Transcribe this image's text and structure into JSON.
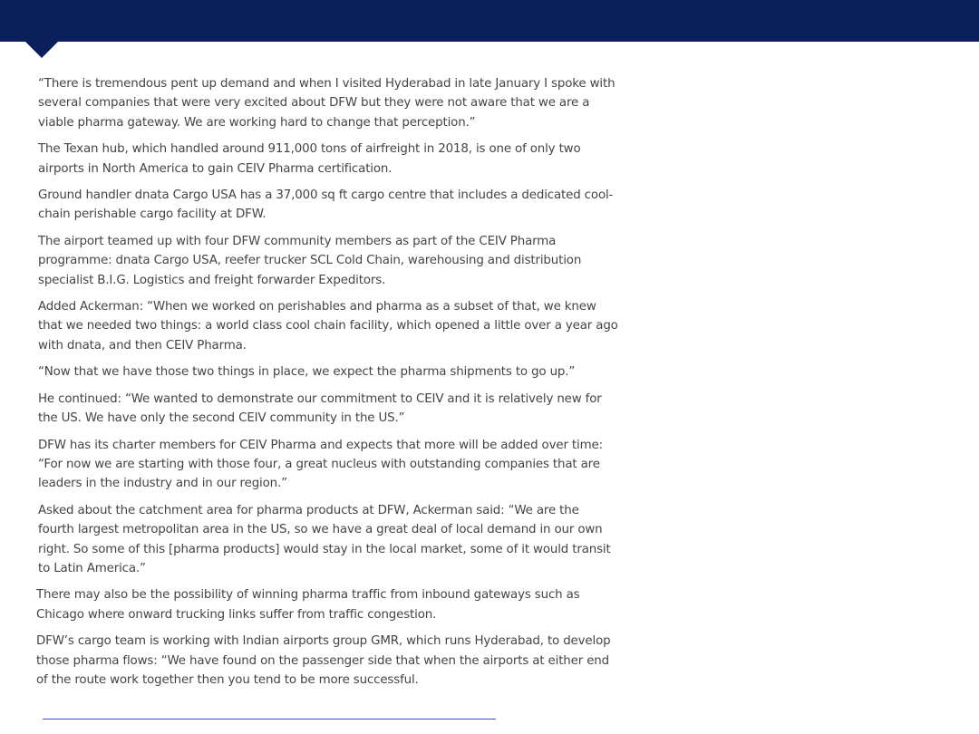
{
  "colors": {
    "header": "#0b1f5c",
    "rule": "#3b4fc8",
    "text": "#444444"
  },
  "article": {
    "paragraphs": [
      "“There is tremendous pent up demand and when I visited Hyderabad in late January I spoke with several companies that were very excited about DFW but they were not aware that we are a viable pharma gateway. We are working hard to change that perception.”",
      "The Texan hub, which handled around 911,000 tons of airfreight in 2018, is one of only two airports in North America to gain CEIV Pharma certification.",
      "Ground handler dnata Cargo USA has a 37,000 sq ft cargo centre that includes a dedicated cool-chain perishable cargo facility at DFW.",
      "The airport teamed up with four DFW community members as part of the CEIV Pharma programme: dnata Cargo USA, reefer trucker SCL Cold Chain, warehousing and distribution specialist B.I.G. Logistics and freight forwarder Expeditors.",
      "Added Ackerman: “When we worked on perishables and pharma as a subset of that, we knew that we needed two things: a world class cool chain facility, which opened a little over a year ago with dnata, and then CEIV Pharma.",
      "“Now that we have those two things in place, we expect the pharma shipments to go up.”",
      "He continued: “We wanted to demonstrate our commitment to CEIV and it is relatively new for the US. We have only the second CEIV community in the US.”",
      "DFW has its charter members for CEIV Pharma and expects that more will be added over time: “For now we are starting with those four, a great nucleus with outstanding companies that are leaders in the industry and in our region.”",
      "Asked about the catchment area for pharma products at DFW, Ackerman said: “We are the fourth largest metropolitan area in the US, so we have a great deal of local demand in our own right. So some of this [pharma products] would stay in the local market, some of it would transit to Latin America.”",
      "There may also be the possibility of winning pharma traffic from inbound gateways such as Chicago where onward trucking links suffer from traffic congestion.",
      "DFW’s cargo team is working with Indian airports group GMR, which runs Hyderabad,  to develop those pharma flows: “We have found on the passenger side that when the airports at either end of the route work together then you tend to be more successful."
    ]
  }
}
